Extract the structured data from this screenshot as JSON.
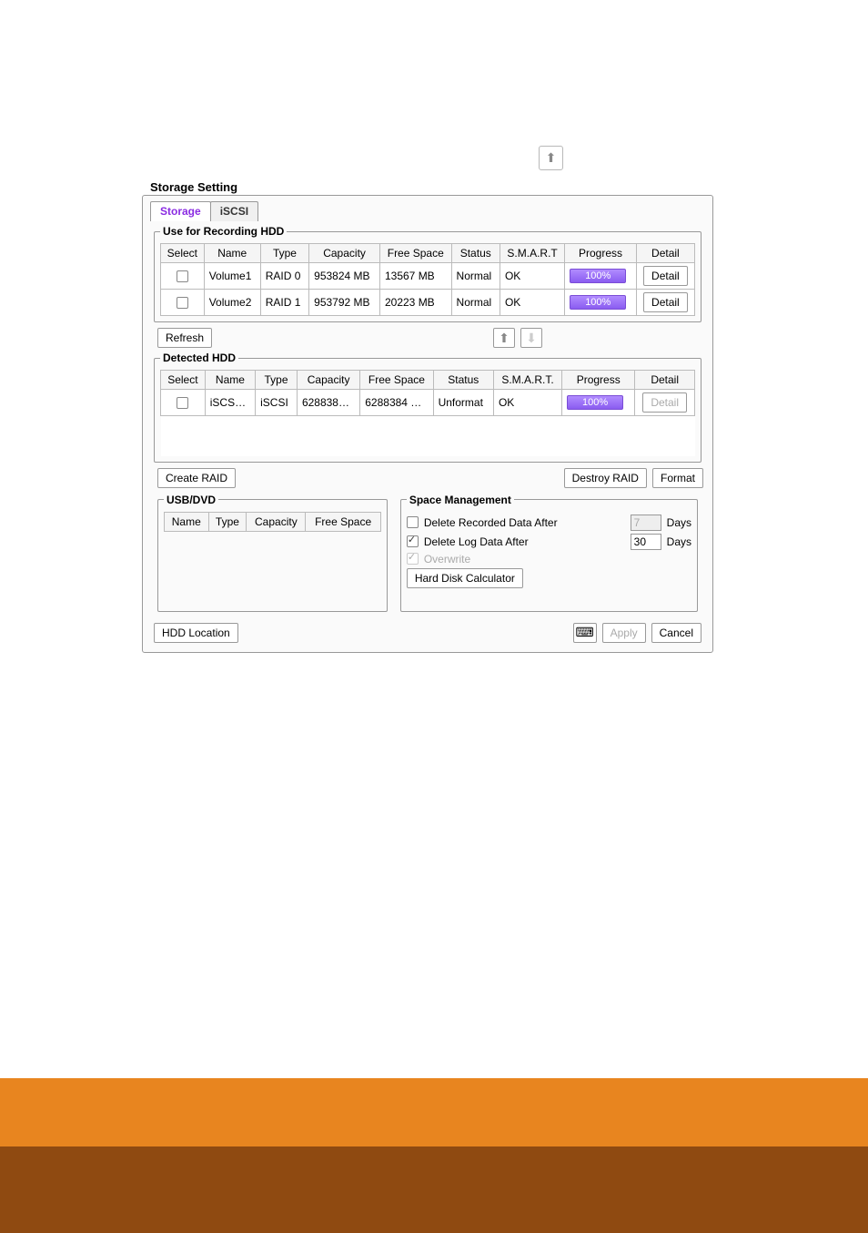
{
  "window": {
    "title": "Storage Setting"
  },
  "tabs": {
    "storage": "Storage",
    "iscsi": "iSCSI"
  },
  "recording": {
    "legend": "Use for Recording HDD",
    "headers": {
      "select": "Select",
      "name": "Name",
      "type": "Type",
      "capacity": "Capacity",
      "freespace": "Free Space",
      "status": "Status",
      "smart": "S.M.A.R.T",
      "progress": "Progress",
      "detail": "Detail"
    },
    "rows": [
      {
        "name": "Volume1",
        "type": "RAID 0",
        "capacity": "953824 MB",
        "freespace": "13567 MB",
        "status": "Normal",
        "smart": "OK",
        "progress": "100%",
        "detail": "Detail"
      },
      {
        "name": "Volume2",
        "type": "RAID 1",
        "capacity": "953792 MB",
        "freespace": "20223 MB",
        "status": "Normal",
        "smart": "OK",
        "progress": "100%",
        "detail": "Detail"
      }
    ]
  },
  "buttons": {
    "refresh": "Refresh",
    "create_raid": "Create RAID",
    "destroy_raid": "Destroy RAID",
    "format": "Format",
    "hdd_location": "HDD Location",
    "hd_calc": "Hard Disk Calculator",
    "apply": "Apply",
    "cancel": "Cancel"
  },
  "detected": {
    "legend": "Detected HDD",
    "headers": {
      "select": "Select",
      "name": "Name",
      "type": "Type",
      "capacity": "Capacity",
      "freespace": "Free Space",
      "status": "Status",
      "smart": "S.M.A.R.T.",
      "progress": "Progress",
      "detail": "Detail"
    },
    "rows": [
      {
        "name": "iSCS…",
        "type": "iSCSI",
        "capacity": "628838…",
        "freespace": "6288384 …",
        "status": "Unformat",
        "smart": "OK",
        "progress": "100%",
        "detail": "Detail"
      }
    ]
  },
  "usb": {
    "legend": "USB/DVD",
    "headers": {
      "name": "Name",
      "type": "Type",
      "capacity": "Capacity",
      "freespace": "Free Space"
    }
  },
  "space": {
    "legend": "Space Management",
    "del_rec": "Delete Recorded Data After",
    "del_rec_days": "7",
    "del_log": "Delete Log Data After",
    "del_log_days": "30",
    "overwrite": "Overwrite",
    "days": "Days"
  }
}
